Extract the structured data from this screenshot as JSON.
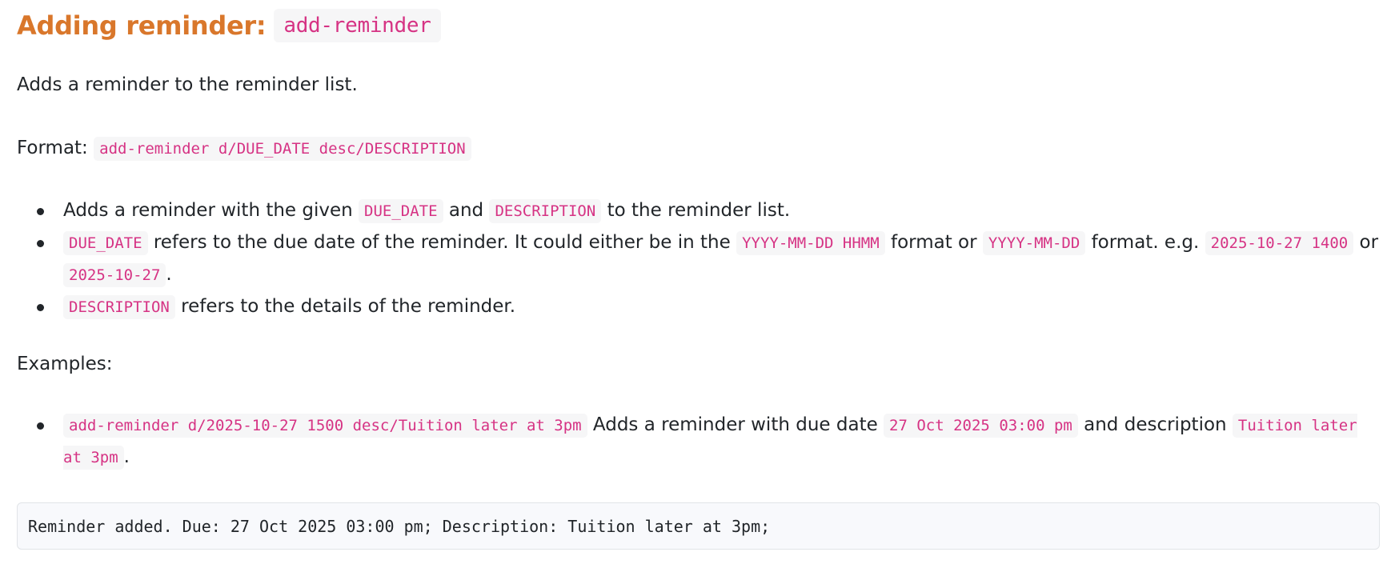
{
  "heading": {
    "text": "Adding reminder:",
    "command": "add-reminder"
  },
  "intro": "Adds a reminder to the reminder list.",
  "format": {
    "label": "Format:",
    "code": "add-reminder d/DUE_DATE desc/DESCRIPTION"
  },
  "bullets": {
    "b1": {
      "t1": "Adds a reminder with the given ",
      "c1": "DUE_DATE",
      "t2": " and ",
      "c2": "DESCRIPTION",
      "t3": " to the reminder list."
    },
    "b2": {
      "c1": "DUE_DATE",
      "t1": " refers to the due date of the reminder. It could either be in the ",
      "c2": "YYYY-MM-DD HHMM",
      "t2": " format or ",
      "c3": "YYYY-MM-DD",
      "t3": " format. e.g. ",
      "c4": "2025-10-27 1400",
      "t4": " or ",
      "c5": "2025-10-27",
      "t5": "."
    },
    "b3": {
      "c1": "DESCRIPTION",
      "t1": " refers to the details of the reminder."
    }
  },
  "examples": {
    "label": "Examples:",
    "e1": {
      "c1": "add-reminder d/2025-10-27 1500 desc/Tuition later at 3pm",
      "t1": " Adds a reminder with due date ",
      "c2": "27 Oct 2025 03:00 pm",
      "t2": " and description ",
      "c3": "Tuition later at 3pm",
      "t3": "."
    }
  },
  "output": "Reminder added. Due: 27 Oct 2025 03:00 pm; Description: Tuition later at 3pm;"
}
